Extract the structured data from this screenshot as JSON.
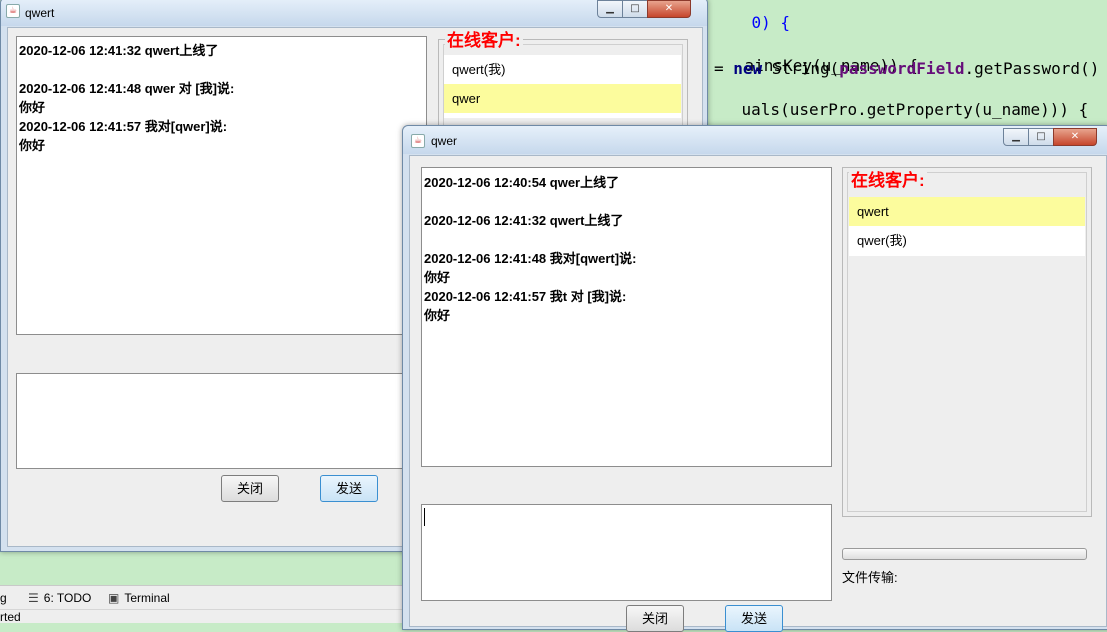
{
  "ide": {
    "code_lines": [
      {
        "prefix": "",
        "kw": "",
        "mid": "",
        "fld": "",
        "suffix": "0) {"
      },
      {
        "prefix": "ainsKey(u_name)) {",
        "kw": "",
        "mid": "",
        "fld": "",
        "suffix": ""
      },
      {
        "prefix": "= ",
        "kw": "new",
        "mid": " String(",
        "fld": "passwordField",
        "suffix": ".getPassword()"
      },
      {
        "prefix": "uals(userPro.getProperty(u_name))) {",
        "kw": "",
        "mid": "",
        "fld": "",
        "suffix": ""
      }
    ],
    "tabs": [
      {
        "label": "g",
        "icon": ""
      },
      {
        "label": "6: TODO",
        "icon": "list-icon"
      },
      {
        "label": "Terminal",
        "icon": "terminal-icon"
      }
    ],
    "status_text": "rted"
  },
  "window_qwert": {
    "title": "qwert",
    "messages": [
      "2020-12-06 12:41:32  qwert上线了",
      "",
      "2020-12-06 12:41:48  qwer 对 [我]说:",
      "你好",
      "2020-12-06 12:41:57 我对[qwer]说:",
      "你好"
    ],
    "online_legend": "在线客户:",
    "online_users": [
      {
        "name": "qwert(我)",
        "selected": false
      },
      {
        "name": "qwer",
        "selected": true
      }
    ],
    "input_value": "",
    "close_label": "关闭",
    "send_label": "发送"
  },
  "window_qwer": {
    "title": "qwer",
    "messages": [
      "2020-12-06 12:40:54  qwer上线了",
      "",
      "2020-12-06 12:41:32  qwert上线了",
      "",
      "2020-12-06 12:41:48 我对[qwert]说:",
      "你好",
      "2020-12-06 12:41:57  我t 对 [我]说:",
      "你好"
    ],
    "online_legend": "在线客户:",
    "online_users": [
      {
        "name": "qwert",
        "selected": true
      },
      {
        "name": "qwer(我)",
        "selected": false
      }
    ],
    "input_value": "",
    "file_transfer_label": "文件传输:",
    "file_transfer_progress": 0,
    "close_label": "关闭",
    "send_label": "发送"
  },
  "colors": {
    "legend": "#ff0000",
    "selected_row": "#fcfc9d",
    "ide_background": "#c7ebc7"
  }
}
